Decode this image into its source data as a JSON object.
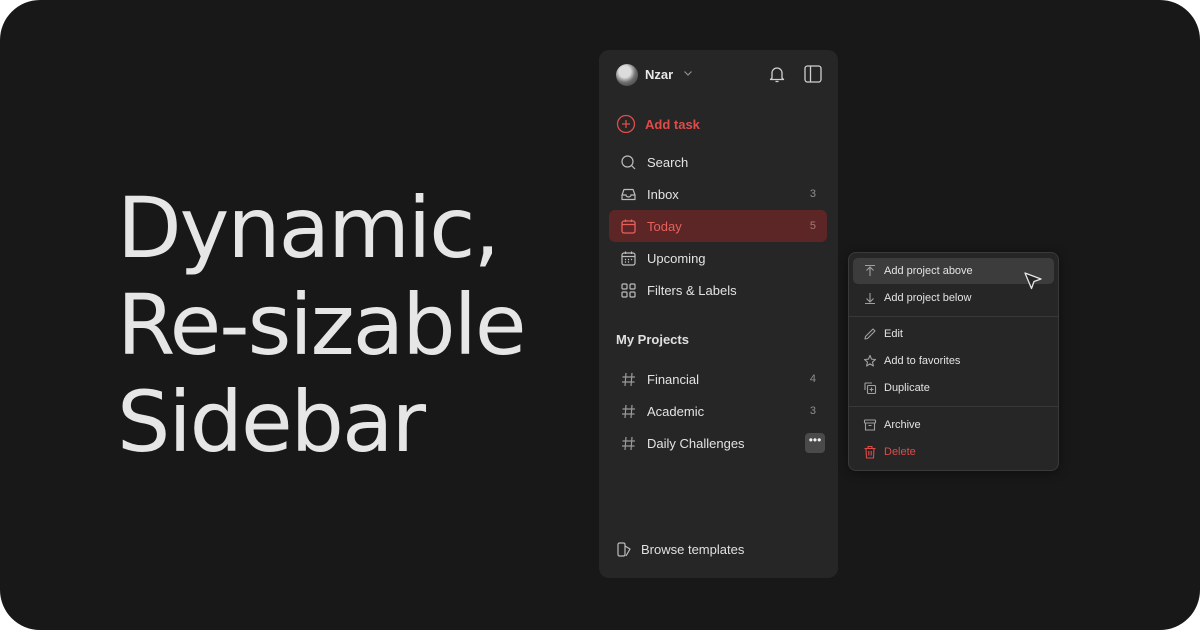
{
  "hero": {
    "lines": [
      "Dynamic,",
      "Re-sizable",
      "Sidebar"
    ]
  },
  "sidebar": {
    "user": {
      "name": "Nzar",
      "avatar_icon": "avatar",
      "dropdown_icon": "chevron-down-icon"
    },
    "header_icons": [
      "bell-icon",
      "sidebar-toggle-icon"
    ],
    "add_task": {
      "label": "Add task",
      "icon": "plus-circle-icon",
      "color": "#de4c4a"
    },
    "nav": [
      {
        "label": "Search",
        "icon": "search-icon",
        "count": ""
      },
      {
        "label": "Inbox",
        "icon": "inbox-icon",
        "count": "3"
      },
      {
        "label": "Today",
        "icon": "calendar-today-icon",
        "count": "5",
        "active": true
      },
      {
        "label": "Upcoming",
        "icon": "calendar-upcoming-icon",
        "count": ""
      },
      {
        "label": "Filters & Labels",
        "icon": "grid-icon",
        "count": ""
      }
    ],
    "projects_title": "My Projects",
    "projects": [
      {
        "label": "Financial",
        "icon": "hash-icon",
        "count": "4"
      },
      {
        "label": "Academic",
        "icon": "hash-icon",
        "count": "3"
      },
      {
        "label": "Daily Challenges",
        "icon": "hash-icon",
        "more": "•••"
      }
    ],
    "browse_templates": {
      "label": "Browse templates",
      "icon": "templates-icon"
    }
  },
  "context_menu": {
    "groups": [
      [
        {
          "label": "Add project above",
          "icon": "arrow-up-icon",
          "hover": true
        },
        {
          "label": "Add project below",
          "icon": "arrow-down-icon"
        }
      ],
      [
        {
          "label": "Edit",
          "icon": "pencil-icon"
        },
        {
          "label": "Add to favorites",
          "icon": "star-icon"
        },
        {
          "label": "Duplicate",
          "icon": "duplicate-icon"
        }
      ],
      [
        {
          "label": "Archive",
          "icon": "archive-icon"
        },
        {
          "label": "Delete",
          "icon": "trash-icon",
          "danger": true
        }
      ]
    ]
  },
  "colors": {
    "background": "#181818",
    "panel": "#262626",
    "accent": "#de4c4a",
    "active_bg": "#5c2526",
    "text": "#e3e3e3",
    "muted": "#8f8f8f"
  }
}
